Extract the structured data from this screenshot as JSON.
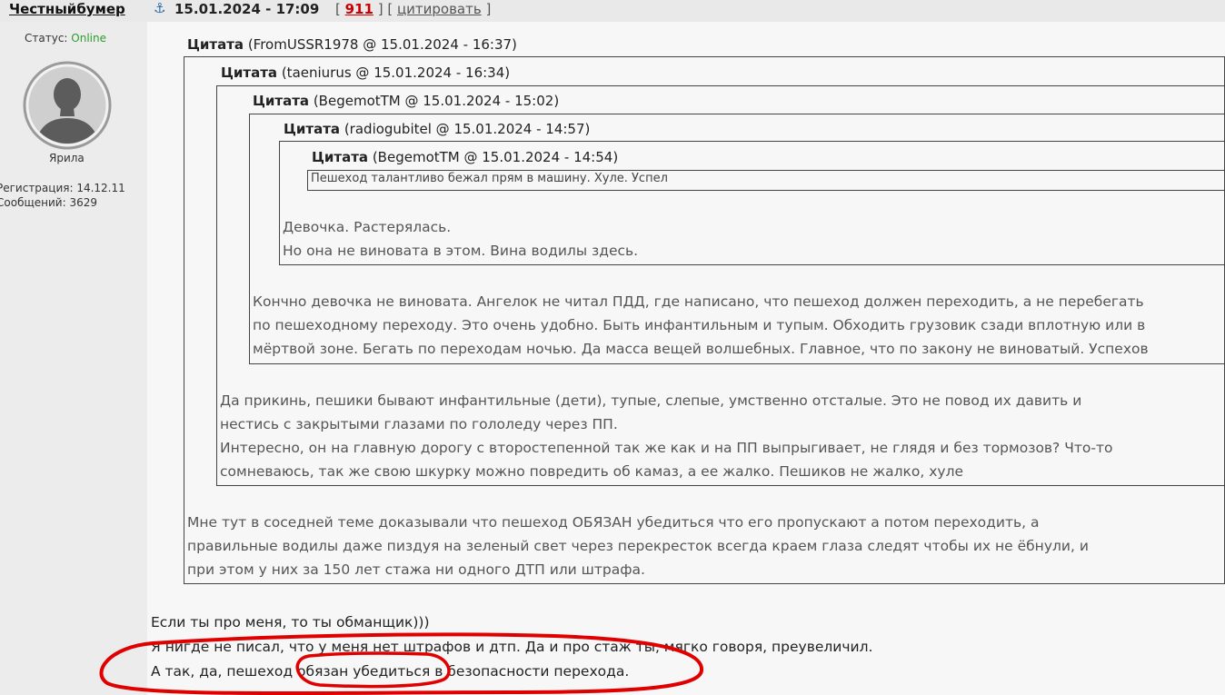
{
  "post": {
    "author": "Честныйбумер",
    "anchor_icon": "anchor-icon",
    "date": "15.01.2024 - 17:09",
    "bracket_open": "[ ",
    "number": "911",
    "bracket_mid": " ] [ ",
    "cite_label": "цитировать",
    "bracket_close": " ]"
  },
  "user": {
    "status_label": "Статус: ",
    "status_value": "Online",
    "name": "Ярила",
    "registration": "Регистрация: 14.12.11",
    "messages": "Сообщений: 3629"
  },
  "quotes": [
    {
      "label": "Цитата",
      "meta": " (FromUSSR1978 @ 15.01.2024 - 16:37)"
    },
    {
      "label": "Цитата",
      "meta": " (taeniurus @ 15.01.2024 - 16:34)"
    },
    {
      "label": "Цитата",
      "meta": " (BegemotTM @ 15.01.2024 - 15:02)"
    },
    {
      "label": "Цитата",
      "meta": " (radiogubitel @ 15.01.2024 - 14:57)"
    },
    {
      "label": "Цитата",
      "meta": " (BegemotTM @ 15.01.2024 - 14:54)"
    }
  ],
  "innermost_text": "Пешеход талантливо бежал прям в машину. Хуле. Успел",
  "level4_text": [
    "Девочка. Растерялась.",
    "Но она не виновата в этом. Вина водилы здесь."
  ],
  "level3_text": [
    "Кончно девочка не виновата. Ангелок не читал ПДД, где написано, что пешеход должен переходить, а не перебегать",
    "по пешеходному переходу. Это очень удобно. Быть инфантильным и тупым. Обходить грузовик сзади вплотную или в",
    "мёртвой зоне. Бегать по переходам ночью. Да масса вещей волшебных. Главное, что по закону не виноватый. Успехов"
  ],
  "level2_text": [
    "Да прикинь, пешики бывают инфантильные (дети), тупые, слепые, умственно отсталые. Это не повод их давить и",
    "нестись с закрытыми глазами по гололеду через ПП.",
    "Интересно, он на главную дорогу с второстепенной так же как и на ПП выпрыгивает, не глядя и без тормозов? Что-то",
    "сомневаюсь, так же свою шкурку можно повредить об камаз, а ее жалко. Пешиков не жалко, хуле"
  ],
  "level1_text": [
    "Мне тут в соседней теме доказывали что пешеход ОБЯЗАН убедиться что его пропускают а потом переходить, а",
    "правильные водилы даже пиздуя на зеленый свет через перекресток всегда краем глаза следят чтобы их не ёбнули, и",
    "при этом у них за 150 лет стажа ни одного ДТП или штрафа."
  ],
  "reply_text": [
    "Если ты про меня, то ты обманщик)))",
    "Я нигде не писал, что у меня нет штрафов и дтп. Да и про стаж ты, мягко говоря, преувеличил.",
    "А так, да, пешеход обязан убедиться в безопасности перехода."
  ],
  "colors": {
    "online": "#2aa02a",
    "post_number": "#cc0000",
    "annotation": "#e00000",
    "anchor": "#2a6aa8"
  }
}
